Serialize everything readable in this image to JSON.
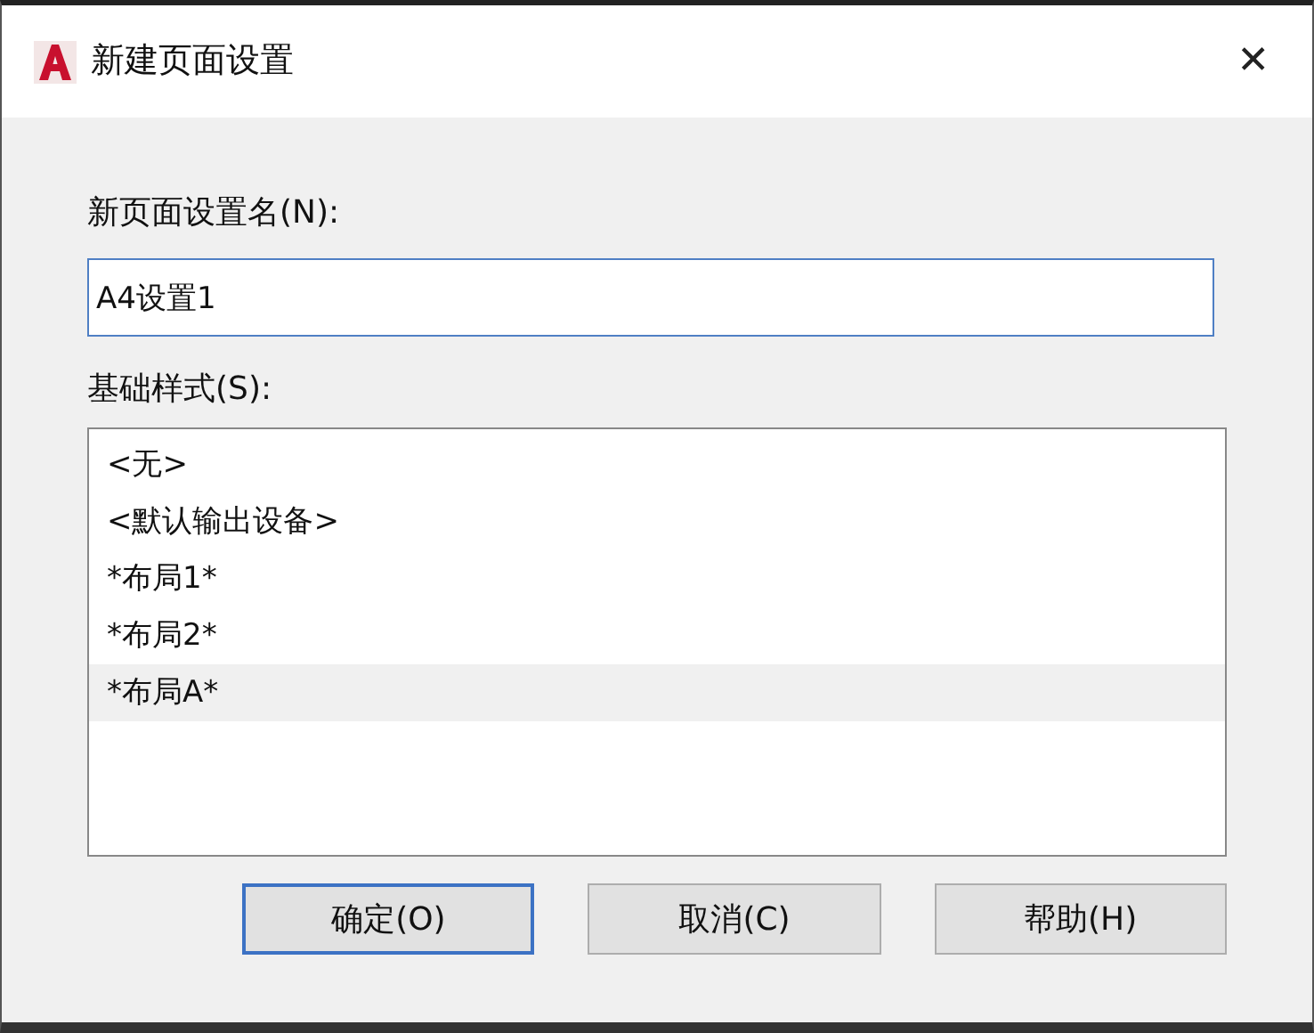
{
  "window": {
    "title": "新建页面设置",
    "close": "✕"
  },
  "name_label": "新页面设置名(N):",
  "name_field": {
    "value": "A4设置1"
  },
  "style_label": "基础样式(S):",
  "styles": [
    {
      "label": "<无>",
      "selected": false
    },
    {
      "label": "<默认输出设备>",
      "selected": false
    },
    {
      "label": "*布局1*",
      "selected": false
    },
    {
      "label": "*布局2*",
      "selected": false
    },
    {
      "label": "*布局A*",
      "selected": true
    }
  ],
  "buttons": [
    {
      "label": "确定(O)",
      "default": true
    },
    {
      "label": "取消(C)",
      "default": false
    },
    {
      "label": "帮助(H)",
      "default": false
    }
  ]
}
